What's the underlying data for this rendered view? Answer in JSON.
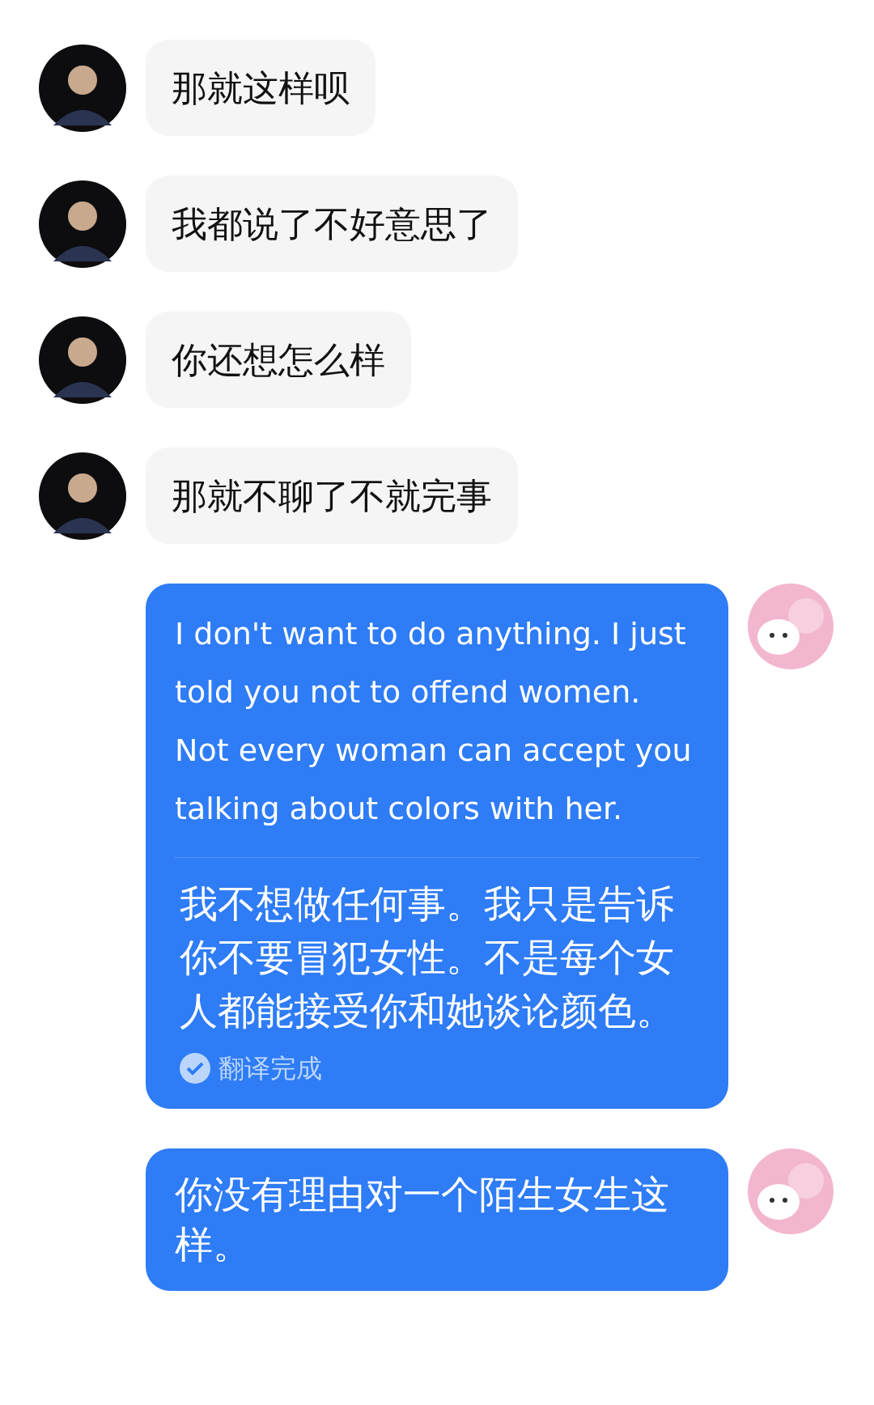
{
  "messages": [
    {
      "kind": "received",
      "text": "那就这样呗"
    },
    {
      "kind": "received",
      "text": "我都说了不好意思了"
    },
    {
      "kind": "received",
      "text": "你还想怎么样"
    },
    {
      "kind": "received",
      "text": "那就不聊了不就完事"
    },
    {
      "kind": "sent",
      "text": "I don't want to do anything. I just told you not to offend women. Not every woman can accept you talking about colors with her.",
      "translation": {
        "text": "我不想做任何事。我只是告诉你不要冒犯女性。不是每个女人都能接受你和她谈论颜色。",
        "status": "翻译完成"
      }
    },
    {
      "kind": "sent",
      "text": "你没有理由对一个陌生女生这样。"
    }
  ]
}
